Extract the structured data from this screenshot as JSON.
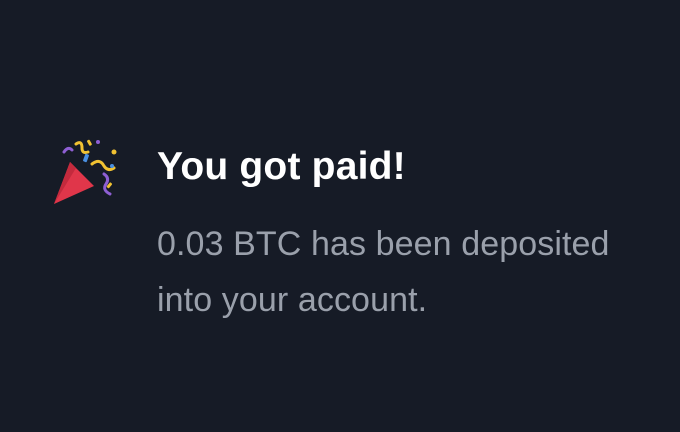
{
  "notification": {
    "icon": "party-popper-icon",
    "title": "You got paid!",
    "message": "0.03 BTC has been deposited into your account."
  },
  "colors": {
    "background": "#161b26",
    "title": "#ffffff",
    "message": "#9aa0ab",
    "popper_cone": "#e0364a",
    "confetti_yellow": "#f1c232",
    "confetti_purple": "#8e5fd3",
    "confetti_blue": "#4a90e2"
  }
}
